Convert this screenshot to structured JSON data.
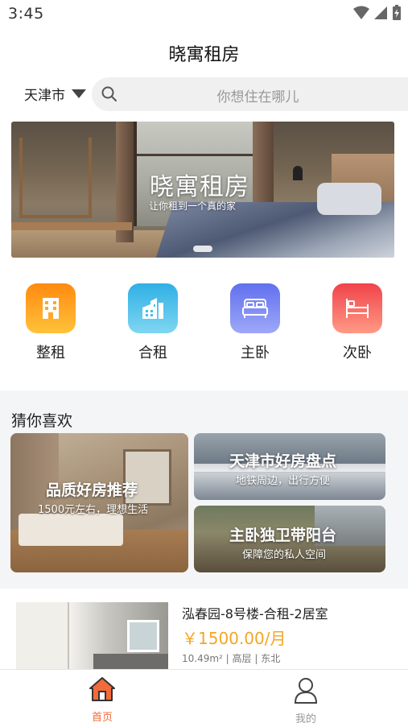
{
  "status_bar": {
    "time": "3:45"
  },
  "header": {
    "title": "晓寓租房"
  },
  "search": {
    "city": "天津市",
    "placeholder": "你想住在哪儿"
  },
  "banner": {
    "title": "晓寓租房",
    "subtitle": "让你租到一个真的家"
  },
  "categories": [
    {
      "label": "整租",
      "icon": "building-icon",
      "color_from": "#ff9a1f",
      "color_to": "#ffc23a"
    },
    {
      "label": "合租",
      "icon": "apartment-icon",
      "color_from": "#3fb9e6",
      "color_to": "#72d1f0"
    },
    {
      "label": "主卧",
      "icon": "double-bed-icon",
      "color_from": "#6b7cf0",
      "color_to": "#9aa6f7"
    },
    {
      "label": "次卧",
      "icon": "single-bed-icon",
      "color_from": "#f24d4d",
      "color_to": "#ff8a7a"
    }
  ],
  "recommend": {
    "title": "猜你喜欢",
    "cards": [
      {
        "title": "品质好房推荐",
        "subtitle": "1500元左右，理想生活"
      },
      {
        "title": "天津市好房盘点",
        "subtitle": "地铁周边，出行方便"
      },
      {
        "title": "主卧独卫带阳台",
        "subtitle": "保障您的私人空间"
      }
    ]
  },
  "listing": {
    "title": "泓春园-8号楼-合租-2居室",
    "price": "￥1500.00/月",
    "meta": "10.49m² | 高层 | 东北"
  },
  "tabbar": {
    "items": [
      {
        "label": "首页",
        "active": true
      },
      {
        "label": "我的",
        "active": false
      }
    ],
    "active_color": "#f26b3a",
    "inactive_color": "#999999"
  }
}
